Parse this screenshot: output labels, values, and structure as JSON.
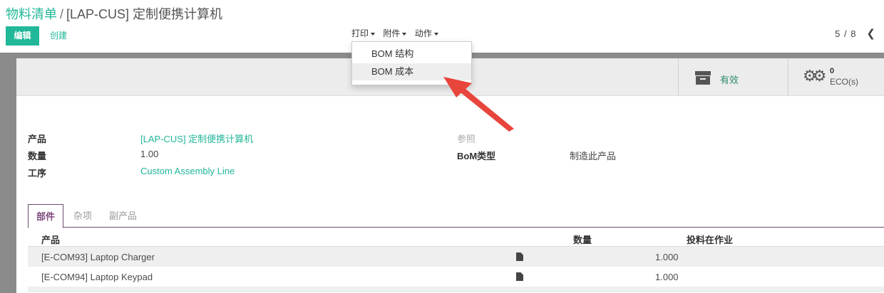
{
  "breadcrumb": {
    "parent": "物料清单",
    "separator": "/",
    "current": "[LAP-CUS] 定制便携计算机"
  },
  "buttons": {
    "edit": "编辑",
    "create": "创建"
  },
  "menus": {
    "print": "打印",
    "attachments": "附件",
    "action": "动作"
  },
  "print_dropdown": {
    "items": [
      "BOM 结构",
      "BOM 成本"
    ],
    "highlighted_index": 1
  },
  "pager": {
    "value": "5 / 8",
    "prev_icon": "chevron-left-icon"
  },
  "stat_buttons": {
    "active_label": "有效",
    "active_icon": "archive-icon",
    "eco_count": "0",
    "eco_label": "ECO(s)",
    "eco_icon": "gears-icon"
  },
  "fields": {
    "product_label": "产品",
    "product_value": "[LAP-CUS] 定制便携计算机",
    "quantity_label": "数量",
    "quantity_value": "1.00",
    "routing_label": "工序",
    "routing_value": "Custom Assembly Line",
    "reference_label": "参照",
    "bom_type_label": "BoM类型",
    "bom_type_value": "制造此产品"
  },
  "tabs": [
    "部件",
    "杂项",
    "副产品"
  ],
  "table": {
    "headers": {
      "product": "产品",
      "quantity": "数量",
      "consumed_in": "投料在作业"
    },
    "rows": [
      {
        "product": "[E-COM93] Laptop Charger",
        "quantity": "1.000"
      },
      {
        "product": "[E-COM94] Laptop Keypad",
        "quantity": "1.000"
      }
    ]
  },
  "colors": {
    "accent": "#21b799",
    "tab_accent": "#7c4b7c",
    "annotation_arrow": "#e8453c"
  }
}
